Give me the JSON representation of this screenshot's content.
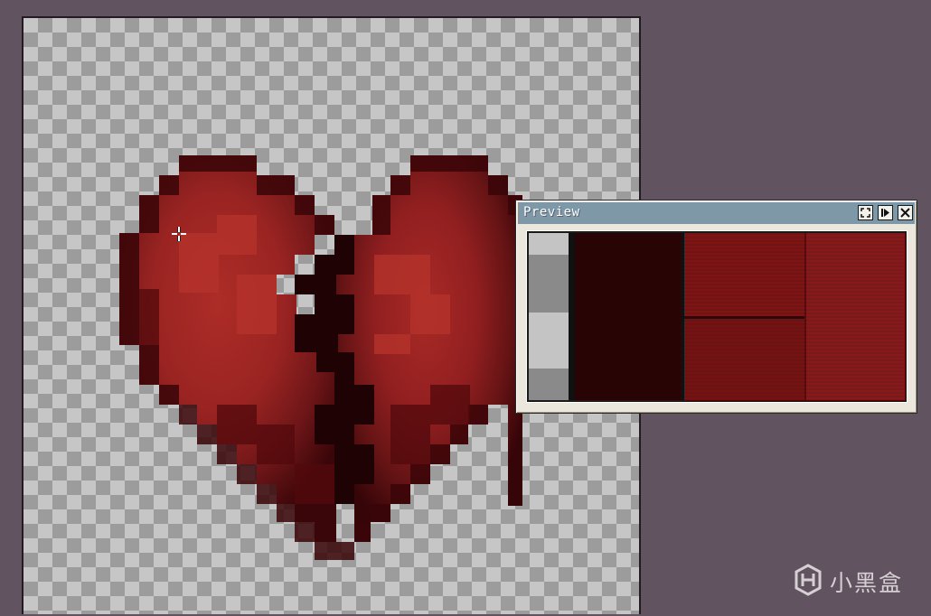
{
  "preview": {
    "title": "Preview",
    "buttons": [
      {
        "icon": "maximize-icon"
      },
      {
        "icon": "play-icon"
      },
      {
        "icon": "close-icon"
      }
    ]
  },
  "canvas": {
    "content": "broken-heart-pixel-art",
    "cursor": "crosshair-cursor-icon"
  },
  "watermark": {
    "text": "小黑盒",
    "icon": "heybox-logo-icon"
  },
  "colors": {
    "workspace": "#625360",
    "heart_light": "#a82a26",
    "heart_mid": "#7e1a1b",
    "heart_dark": "#3e0709",
    "crack": "#1f0204",
    "titlebar": "#7f98a8"
  }
}
